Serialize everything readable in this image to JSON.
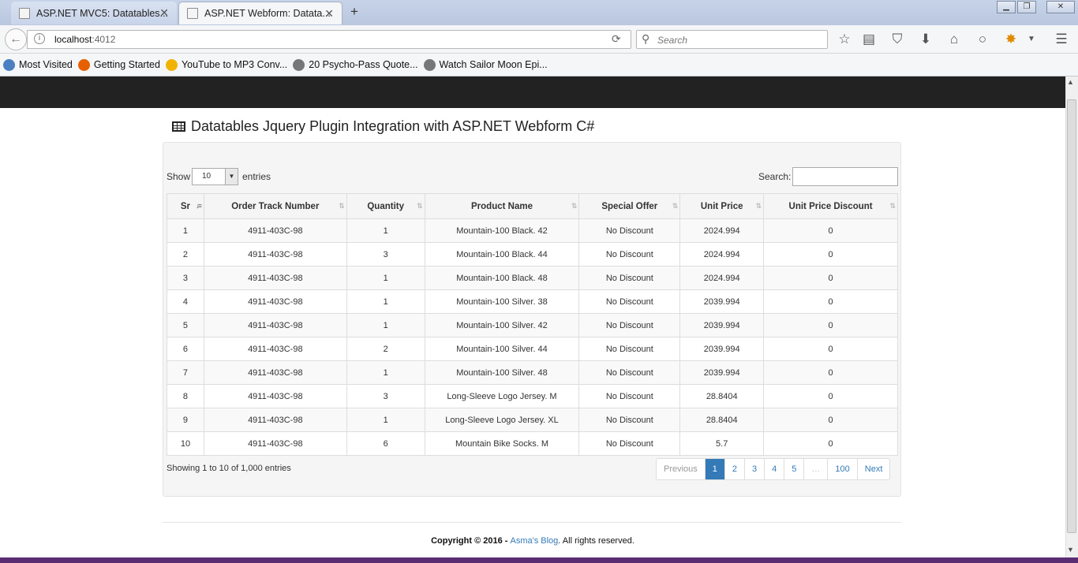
{
  "browser": {
    "tabs": [
      {
        "title": "ASP.NET MVC5: Datatables..."
      },
      {
        "title": "ASP.NET Webform: Datata..."
      }
    ],
    "url_host": "localhost",
    "url_port": ":4012",
    "search_placeholder": "Search",
    "bookmarks": [
      {
        "label": "Most Visited",
        "color": "#4a7fc1"
      },
      {
        "label": "Getting Started",
        "color": "#e66000"
      },
      {
        "label": "YouTube to MP3 Conv...",
        "color": "#f0b400"
      },
      {
        "label": "20 Psycho-Pass Quote...",
        "color": "#777777"
      },
      {
        "label": "Watch Sailor Moon Epi...",
        "color": "#777777"
      }
    ]
  },
  "page": {
    "heading": "Datatables Jquery Plugin Integration with ASP.NET Webform C#",
    "show_label": "Show",
    "length_value": "10",
    "entries_label": "entries",
    "search_label": "Search:",
    "columns": [
      "Sr",
      "Order Track Number",
      "Quantity",
      "Product Name",
      "Special Offer",
      "Unit Price",
      "Unit Price Discount"
    ],
    "rows": [
      [
        "1",
        "4911-403C-98",
        "1",
        "Mountain-100 Black. 42",
        "No Discount",
        "2024.994",
        "0"
      ],
      [
        "2",
        "4911-403C-98",
        "3",
        "Mountain-100 Black. 44",
        "No Discount",
        "2024.994",
        "0"
      ],
      [
        "3",
        "4911-403C-98",
        "1",
        "Mountain-100 Black. 48",
        "No Discount",
        "2024.994",
        "0"
      ],
      [
        "4",
        "4911-403C-98",
        "1",
        "Mountain-100 Silver. 38",
        "No Discount",
        "2039.994",
        "0"
      ],
      [
        "5",
        "4911-403C-98",
        "1",
        "Mountain-100 Silver. 42",
        "No Discount",
        "2039.994",
        "0"
      ],
      [
        "6",
        "4911-403C-98",
        "2",
        "Mountain-100 Silver. 44",
        "No Discount",
        "2039.994",
        "0"
      ],
      [
        "7",
        "4911-403C-98",
        "1",
        "Mountain-100 Silver. 48",
        "No Discount",
        "2039.994",
        "0"
      ],
      [
        "8",
        "4911-403C-98",
        "3",
        "Long-Sleeve Logo Jersey. M",
        "No Discount",
        "28.8404",
        "0"
      ],
      [
        "9",
        "4911-403C-98",
        "1",
        "Long-Sleeve Logo Jersey. XL",
        "No Discount",
        "28.8404",
        "0"
      ],
      [
        "10",
        "4911-403C-98",
        "6",
        "Mountain Bike Socks. M",
        "No Discount",
        "5.7",
        "0"
      ]
    ],
    "info": "Showing 1 to 10 of 1,000 entries",
    "pager": [
      "Previous",
      "1",
      "2",
      "3",
      "4",
      "5",
      "…",
      "100",
      "Next"
    ],
    "active_page": "1",
    "footer_prefix": "Copyright © 2016 - ",
    "footer_link": "Asma's Blog",
    "footer_suffix": ". All rights reserved."
  },
  "colors": {
    "accent": "#337ab7",
    "navbar": "#222222"
  }
}
